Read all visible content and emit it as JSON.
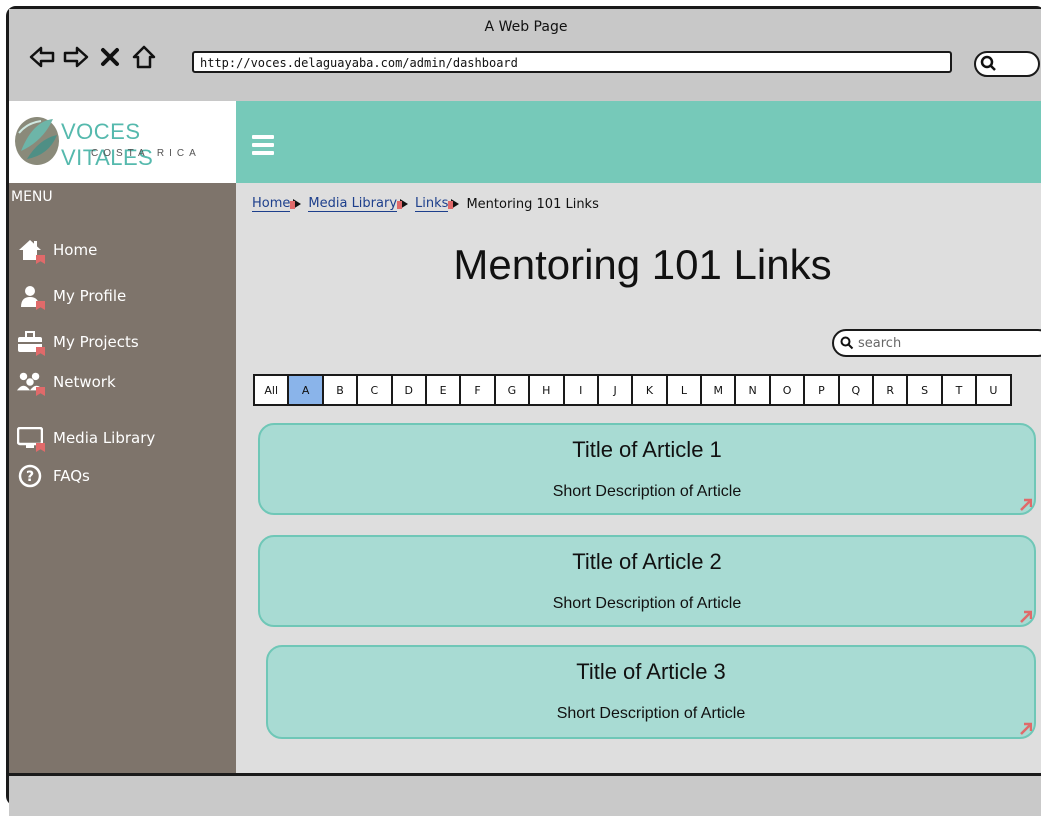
{
  "window": {
    "title": "A Web Page",
    "url": "http://voces.delaguayaba.com/admin/dashboard"
  },
  "logo": {
    "name": "VOCES VITALES",
    "sub": "COSTA RICA"
  },
  "sidebar": {
    "menu_label": "MENU",
    "items": [
      {
        "label": "Home",
        "icon": "home-icon"
      },
      {
        "label": "My Profile",
        "icon": "user-icon"
      },
      {
        "label": "My Projects",
        "icon": "briefcase-icon"
      },
      {
        "label": "Network",
        "icon": "network-icon"
      },
      {
        "label": "Media Library",
        "icon": "monitor-icon"
      },
      {
        "label": "FAQs",
        "icon": "question-icon"
      }
    ]
  },
  "breadcrumb": {
    "items": [
      "Home",
      "Media Library",
      "Links"
    ],
    "current": "Mentoring 101 Links"
  },
  "page": {
    "title": "Mentoring 101 Links"
  },
  "search": {
    "placeholder": "search"
  },
  "alphabet": {
    "letters": [
      "All",
      "A",
      "B",
      "C",
      "D",
      "E",
      "F",
      "G",
      "H",
      "I",
      "J",
      "K",
      "L",
      "M",
      "N",
      "O",
      "P",
      "Q",
      "R",
      "S",
      "T",
      "U"
    ],
    "active": "A"
  },
  "articles": [
    {
      "title": "Title of Article 1",
      "description": "Short Description of Article"
    },
    {
      "title": "Title of Article 2",
      "description": "Short Description of Article"
    },
    {
      "title": "Title of Article 3",
      "description": "Short Description of Article"
    }
  ],
  "colors": {
    "topbar": "#76c9b9",
    "sidebar": "#7e746b",
    "card": "#a8dbd3",
    "active_letter": "#8ab4ea",
    "link": "#1d3f8c"
  }
}
